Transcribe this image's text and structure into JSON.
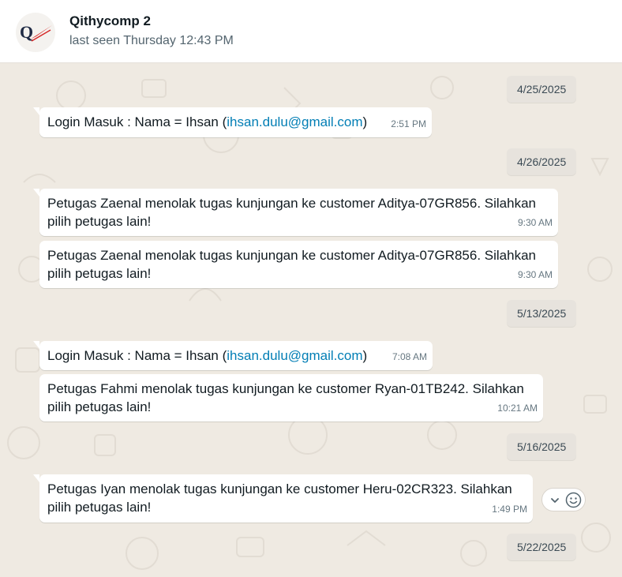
{
  "header": {
    "contact_name": "Qithycomp 2",
    "status": "last seen Thursday 12:43 PM",
    "avatar_initial": "Q"
  },
  "chat": {
    "dates": [
      "4/25/2025",
      "4/26/2025",
      "5/13/2025",
      "5/16/2025",
      "5/22/2025"
    ],
    "messages": [
      {
        "prefix": "Login Masuk : Nama = Ihsan (",
        "link": "ihsan.dulu@gmail.com",
        "suffix": ")",
        "time": "2:51 PM"
      },
      {
        "line1": "Petugas Zaenal menolak tugas kunjungan ke customer Aditya-07GR856. Silahkan",
        "line2": "pilih petugas lain!",
        "time": "9:30 AM"
      },
      {
        "line1": "Petugas Zaenal menolak tugas kunjungan ke customer Aditya-07GR856. Silahkan",
        "line2": "pilih petugas lain!",
        "time": "9:30 AM"
      },
      {
        "prefix": "Login Masuk : Nama = Ihsan (",
        "link": "ihsan.dulu@gmail.com",
        "suffix": ")",
        "time": "7:08 AM"
      },
      {
        "line1": "Petugas Fahmi menolak tugas kunjungan ke customer Ryan-01TB242. Silahkan",
        "line2": "pilih petugas lain!",
        "time": "10:21 AM"
      },
      {
        "line1": "Petugas Iyan menolak tugas kunjungan ke customer Heru-02CR323. Silahkan",
        "line2": "pilih petugas lain!",
        "time": "1:49 PM"
      }
    ]
  },
  "icons": {
    "dropdown": "chevron-down-icon",
    "reaction": "smiley-icon"
  },
  "colors": {
    "wallpaper": "#efeae2",
    "bubble": "#ffffff",
    "link": "#027eb5",
    "date_chip": "#e7e3dd",
    "logo_red": "#d62828",
    "logo_dark": "#1f2a44"
  }
}
